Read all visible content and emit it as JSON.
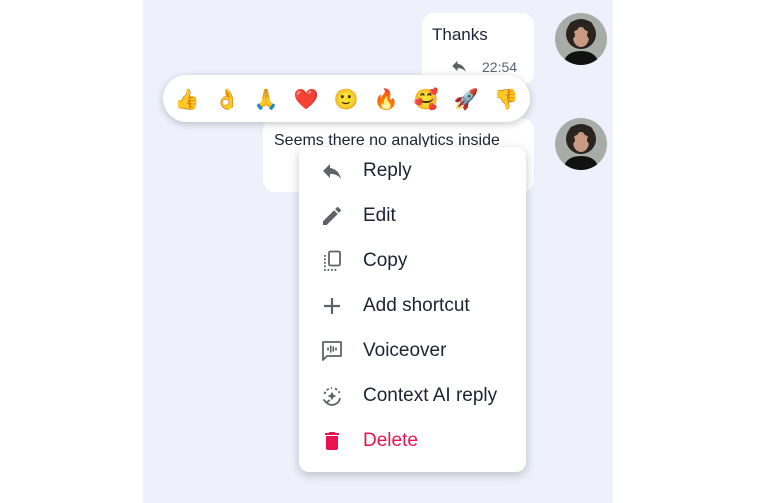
{
  "messages": [
    {
      "text": "Thanks",
      "time": "22:54"
    },
    {
      "text": "Seems there no analytics inside"
    }
  ],
  "reactions": [
    {
      "emoji": "👍",
      "name": "thumbs-up"
    },
    {
      "emoji": "👌",
      "name": "ok-hand"
    },
    {
      "emoji": "🙏",
      "name": "folded-hands"
    },
    {
      "emoji": "❤️",
      "name": "red-heart"
    },
    {
      "emoji": "🙂",
      "name": "slightly-smiling-face"
    },
    {
      "emoji": "🔥",
      "name": "fire"
    },
    {
      "emoji": "🥰",
      "name": "smiling-face-with-hearts"
    },
    {
      "emoji": "🚀",
      "name": "rocket"
    },
    {
      "emoji": "👎",
      "name": "thumbs-down"
    }
  ],
  "menu": {
    "reply": "Reply",
    "edit": "Edit",
    "copy": "Copy",
    "add_shortcut": "Add shortcut",
    "voiceover": "Voiceover",
    "context_ai_reply": "Context AI reply",
    "delete": "Delete"
  },
  "colors": {
    "chat_background": "#eef1fb",
    "text": "#1d2333",
    "icon": "#5f6368",
    "danger": "#e8134f"
  },
  "icons": {
    "reply": "reply-icon",
    "edit": "pencil-icon",
    "copy": "copy-icon",
    "add_shortcut": "plus-icon",
    "voiceover": "voiceover-icon",
    "context_ai_reply": "ai-sparkle-icon",
    "delete": "trash-icon"
  }
}
